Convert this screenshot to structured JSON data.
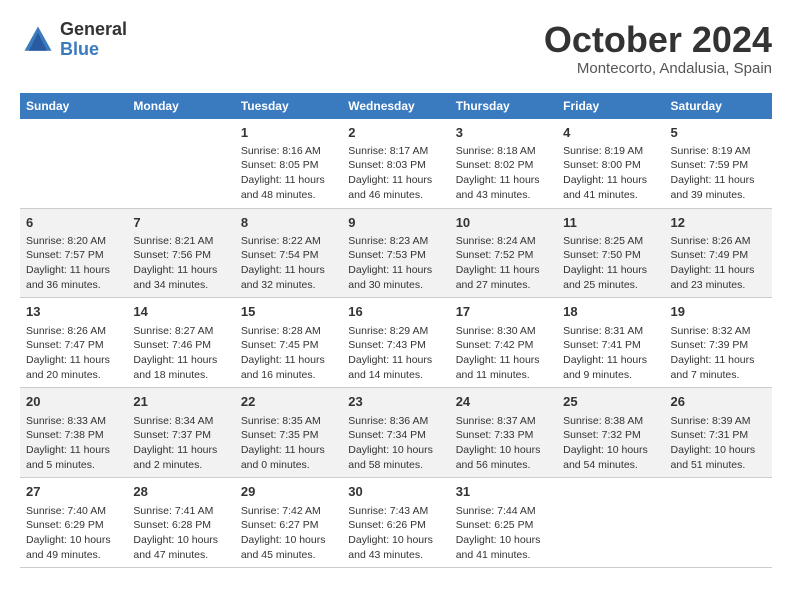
{
  "header": {
    "logo_line1": "General",
    "logo_line2": "Blue",
    "month": "October 2024",
    "location": "Montecorto, Andalusia, Spain"
  },
  "days_of_week": [
    "Sunday",
    "Monday",
    "Tuesday",
    "Wednesday",
    "Thursday",
    "Friday",
    "Saturday"
  ],
  "weeks": [
    [
      {
        "day": "",
        "text": ""
      },
      {
        "day": "",
        "text": ""
      },
      {
        "day": "1",
        "text": "Sunrise: 8:16 AM\nSunset: 8:05 PM\nDaylight: 11 hours and 48 minutes."
      },
      {
        "day": "2",
        "text": "Sunrise: 8:17 AM\nSunset: 8:03 PM\nDaylight: 11 hours and 46 minutes."
      },
      {
        "day": "3",
        "text": "Sunrise: 8:18 AM\nSunset: 8:02 PM\nDaylight: 11 hours and 43 minutes."
      },
      {
        "day": "4",
        "text": "Sunrise: 8:19 AM\nSunset: 8:00 PM\nDaylight: 11 hours and 41 minutes."
      },
      {
        "day": "5",
        "text": "Sunrise: 8:19 AM\nSunset: 7:59 PM\nDaylight: 11 hours and 39 minutes."
      }
    ],
    [
      {
        "day": "6",
        "text": "Sunrise: 8:20 AM\nSunset: 7:57 PM\nDaylight: 11 hours and 36 minutes."
      },
      {
        "day": "7",
        "text": "Sunrise: 8:21 AM\nSunset: 7:56 PM\nDaylight: 11 hours and 34 minutes."
      },
      {
        "day": "8",
        "text": "Sunrise: 8:22 AM\nSunset: 7:54 PM\nDaylight: 11 hours and 32 minutes."
      },
      {
        "day": "9",
        "text": "Sunrise: 8:23 AM\nSunset: 7:53 PM\nDaylight: 11 hours and 30 minutes."
      },
      {
        "day": "10",
        "text": "Sunrise: 8:24 AM\nSunset: 7:52 PM\nDaylight: 11 hours and 27 minutes."
      },
      {
        "day": "11",
        "text": "Sunrise: 8:25 AM\nSunset: 7:50 PM\nDaylight: 11 hours and 25 minutes."
      },
      {
        "day": "12",
        "text": "Sunrise: 8:26 AM\nSunset: 7:49 PM\nDaylight: 11 hours and 23 minutes."
      }
    ],
    [
      {
        "day": "13",
        "text": "Sunrise: 8:26 AM\nSunset: 7:47 PM\nDaylight: 11 hours and 20 minutes."
      },
      {
        "day": "14",
        "text": "Sunrise: 8:27 AM\nSunset: 7:46 PM\nDaylight: 11 hours and 18 minutes."
      },
      {
        "day": "15",
        "text": "Sunrise: 8:28 AM\nSunset: 7:45 PM\nDaylight: 11 hours and 16 minutes."
      },
      {
        "day": "16",
        "text": "Sunrise: 8:29 AM\nSunset: 7:43 PM\nDaylight: 11 hours and 14 minutes."
      },
      {
        "day": "17",
        "text": "Sunrise: 8:30 AM\nSunset: 7:42 PM\nDaylight: 11 hours and 11 minutes."
      },
      {
        "day": "18",
        "text": "Sunrise: 8:31 AM\nSunset: 7:41 PM\nDaylight: 11 hours and 9 minutes."
      },
      {
        "day": "19",
        "text": "Sunrise: 8:32 AM\nSunset: 7:39 PM\nDaylight: 11 hours and 7 minutes."
      }
    ],
    [
      {
        "day": "20",
        "text": "Sunrise: 8:33 AM\nSunset: 7:38 PM\nDaylight: 11 hours and 5 minutes."
      },
      {
        "day": "21",
        "text": "Sunrise: 8:34 AM\nSunset: 7:37 PM\nDaylight: 11 hours and 2 minutes."
      },
      {
        "day": "22",
        "text": "Sunrise: 8:35 AM\nSunset: 7:35 PM\nDaylight: 11 hours and 0 minutes."
      },
      {
        "day": "23",
        "text": "Sunrise: 8:36 AM\nSunset: 7:34 PM\nDaylight: 10 hours and 58 minutes."
      },
      {
        "day": "24",
        "text": "Sunrise: 8:37 AM\nSunset: 7:33 PM\nDaylight: 10 hours and 56 minutes."
      },
      {
        "day": "25",
        "text": "Sunrise: 8:38 AM\nSunset: 7:32 PM\nDaylight: 10 hours and 54 minutes."
      },
      {
        "day": "26",
        "text": "Sunrise: 8:39 AM\nSunset: 7:31 PM\nDaylight: 10 hours and 51 minutes."
      }
    ],
    [
      {
        "day": "27",
        "text": "Sunrise: 7:40 AM\nSunset: 6:29 PM\nDaylight: 10 hours and 49 minutes."
      },
      {
        "day": "28",
        "text": "Sunrise: 7:41 AM\nSunset: 6:28 PM\nDaylight: 10 hours and 47 minutes."
      },
      {
        "day": "29",
        "text": "Sunrise: 7:42 AM\nSunset: 6:27 PM\nDaylight: 10 hours and 45 minutes."
      },
      {
        "day": "30",
        "text": "Sunrise: 7:43 AM\nSunset: 6:26 PM\nDaylight: 10 hours and 43 minutes."
      },
      {
        "day": "31",
        "text": "Sunrise: 7:44 AM\nSunset: 6:25 PM\nDaylight: 10 hours and 41 minutes."
      },
      {
        "day": "",
        "text": ""
      },
      {
        "day": "",
        "text": ""
      }
    ]
  ]
}
